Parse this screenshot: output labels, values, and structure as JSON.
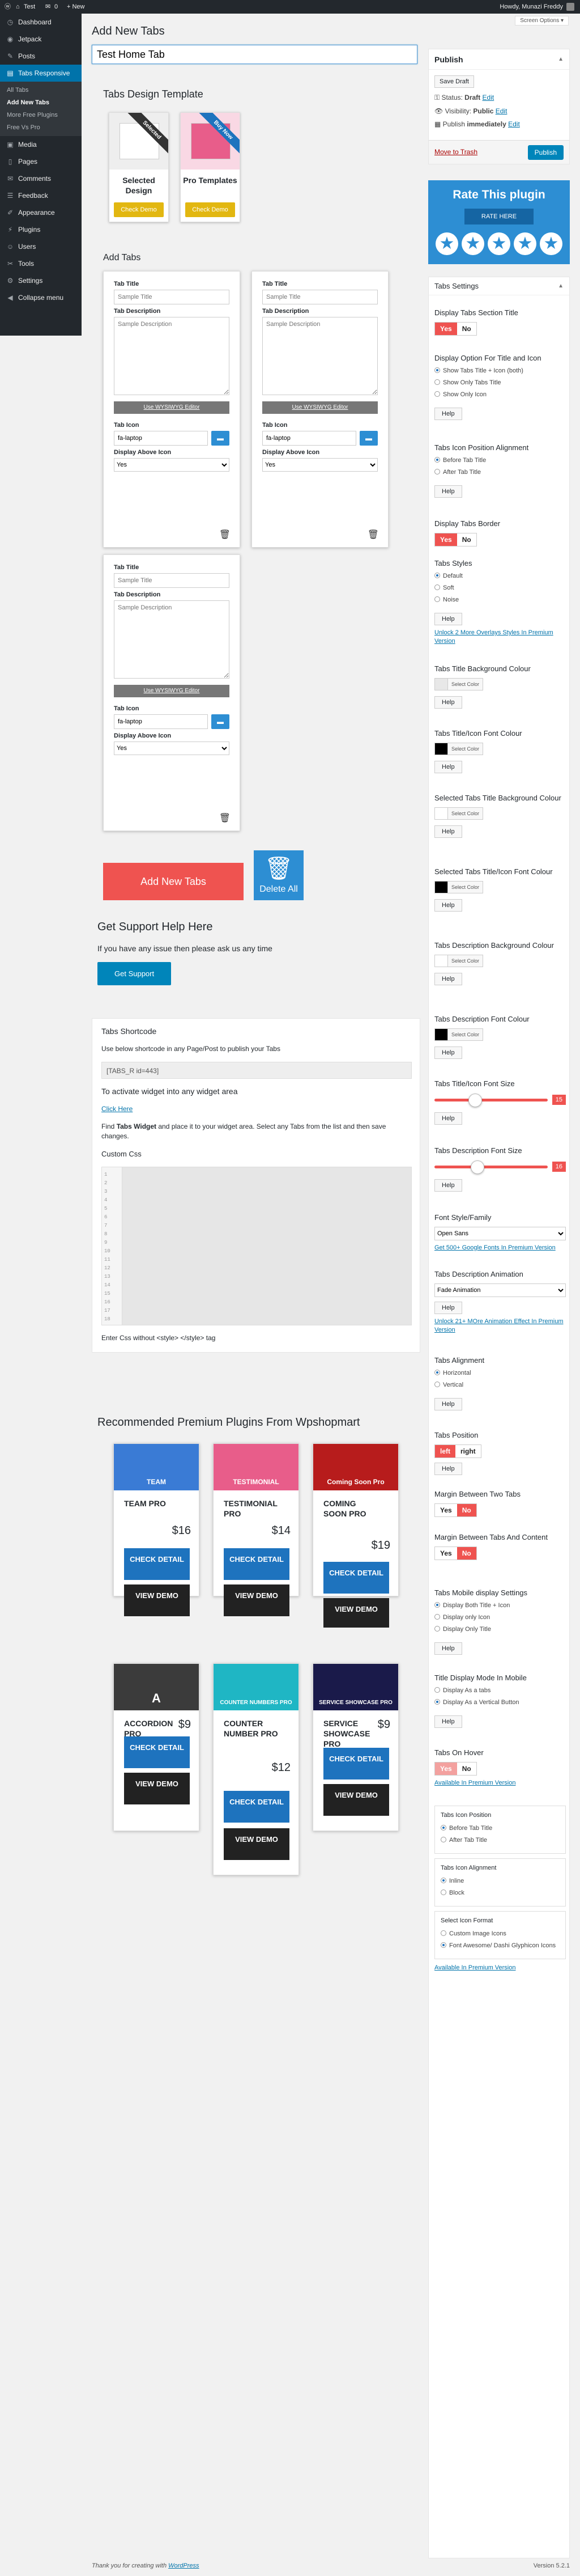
{
  "adminbar": {
    "wp_logo": "wordpress-logo",
    "site_name": "Test",
    "comments_count": "0",
    "new_label": "+ New",
    "greeting": "Howdy, Munazi Freddy"
  },
  "screen_options": "Screen Options ▾",
  "sidebar_menu": {
    "dashboard": "Dashboard",
    "jetpack": "Jetpack",
    "posts": "Posts",
    "tabs_responsive": "Tabs Responsive",
    "sub_all_tabs": "All Tabs",
    "sub_add_new": "Add New Tabs",
    "sub_more_free": "More Free Plugins",
    "sub_free_vs_pro": "Free Vs Pro",
    "media": "Media",
    "pages": "Pages",
    "comments": "Comments",
    "feedback": "Feedback",
    "appearance": "Appearance",
    "plugins": "Plugins",
    "users": "Users",
    "tools": "Tools",
    "settings": "Settings",
    "collapse": "Collapse menu"
  },
  "page": {
    "title": "Add New Tabs",
    "post_title_value": "Test Home Tab"
  },
  "design": {
    "heading": "Tabs Design Template",
    "card1_name": "Selected Design",
    "card1_ribbon": "Selected",
    "card1_button": "Check Demo",
    "card2_name": "Pro Templates",
    "card2_ribbon": "Buy Now",
    "card2_button": "Check Demo"
  },
  "add_tabs": {
    "heading": "Add Tabs",
    "title_label": "Tab Title",
    "title_placeholder": "Sample Title",
    "desc_label": "Tab Description",
    "desc_placeholder": "Sample Description",
    "editor_button": "Use WYSIWYG Editor",
    "icon_label": "Tab Icon",
    "icon_value": "fa-laptop",
    "display_label": "Display Above Icon",
    "display_value": "Yes",
    "add_button": "Add New Tabs",
    "delete_all": "Delete All"
  },
  "support": {
    "heading": "Get Support Help Here",
    "text": "If you have any issue then please ask us any time",
    "button": "Get Support"
  },
  "shortcode": {
    "heading": "Tabs Shortcode",
    "instruction": "Use below shortcode in any Page/Post to publish your Tabs",
    "code": "[TABS_R id=443]",
    "widget_heading": "To activate widget into any widget area",
    "click_here": "Click Here",
    "find_text_1": "Find ",
    "find_bold": "Tabs Widget",
    "find_text_2": " and place it to your widget area. Select any Tabs from the list and then save changes.",
    "custom_css_label": "Custom Css",
    "line_numbers": "1\n2\n3\n4\n5\n6\n7\n8\n9\n10\n11\n12\n13\n14\n15\n16\n17\n18",
    "css_note": "Enter Css without <style> </style> tag"
  },
  "recommended": {
    "heading": "Recommended Premium Plugins From Wpshopmart",
    "check_detail": "CHECK DETAIL",
    "view_demo": "VIEW DEMO",
    "plugins": [
      {
        "name": "TEAM PRO",
        "price": "$16",
        "banner": "TEAM",
        "color": "#3a7bd5"
      },
      {
        "name": "TESTIMONIAL PRO",
        "price": "$14",
        "banner": "TESTIMONIAL",
        "color": "#e85d8a"
      },
      {
        "name": "COMING SOON PRO",
        "price": "$19",
        "banner": "Coming Soon Pro",
        "color": "#b71c1c"
      },
      {
        "name": "ACCORDION PRO",
        "price": "$9",
        "banner": "A",
        "color": "#3b3b3b"
      },
      {
        "name": "COUNTER NUMBER PRO",
        "price": "$12",
        "banner": "COUNTER NUMBERS PRO",
        "color": "#1fb6c4"
      },
      {
        "name": "SERVICE SHOWCASE PRO",
        "price": "$9",
        "banner": "SERVICE SHOWCASE PRO",
        "color": "#1a1a4a"
      }
    ]
  },
  "publish": {
    "heading": "Publish",
    "save_draft": "Save Draft",
    "status": "Status: ",
    "status_value": "Draft",
    "visibility": "Visibility: ",
    "visibility_value": "Public",
    "publish_text": "Publish ",
    "publish_value": "immediately",
    "edit": "Edit",
    "move_trash": "Move to Trash",
    "publish_button": "Publish"
  },
  "rate": {
    "title": "Rate This plugin",
    "button": "RATE HERE",
    "star": "★"
  },
  "settings": {
    "heading": "Tabs Settings",
    "yes": "Yes",
    "no": "No",
    "help": "Help",
    "select_color": "Select Color",
    "display_section_title": "Display Tabs Section Title",
    "display_option": "Display Option For Title and Icon",
    "opt_title_icon": "Show Tabs Title + Icon (both)",
    "opt_only_title": "Show Only Tabs Title",
    "opt_only_icon": "Show Only Icon",
    "icon_position": "Tabs Icon Position Alignment",
    "before_title": "Before Tab Title",
    "after_title": "After Tab Title",
    "display_border": "Display Tabs Border",
    "tabs_styles": "Tabs Styles",
    "style_default": "Default",
    "style_soft": "Soft",
    "style_noise": "Noise",
    "styles_promo": "Unlock 2 More Overlays Styles In Premium Version",
    "title_bg": "Tabs Title Background Colour",
    "title_font_color": "Tabs Title/Icon Font Colour",
    "selected_bg": "Selected Tabs Title Background Colour",
    "selected_font": "Selected Tabs Title/Icon Font Colour",
    "desc_bg": "Tabs Description Background Colour",
    "desc_font": "Tabs Description Font Colour",
    "title_font_size": "Tabs Title/Icon Font Size",
    "title_font_size_value": "15",
    "desc_font_size": "Tabs Description Font Size",
    "desc_font_size_value": "16",
    "font_family": "Font Style/Family",
    "font_family_value": "Open Sans",
    "font_promo": "Get 500+ Google Fonts In Premium Version",
    "animation": "Tabs Description Animation",
    "animation_value": "Fade Animation",
    "animation_promo": "Unlock 21+ MOre Animation Effect In Premium Version",
    "alignment": "Tabs Alignment",
    "horizontal": "Horizontal",
    "vertical": "Vertical",
    "position": "Tabs Position",
    "left": "left",
    "right": "right",
    "margin_tabs": "Margin Between Two Tabs",
    "margin_content": "Margin Between Tabs And Content",
    "mobile": "Tabs Mobile display Settings",
    "mob_both": "Display Both Title + Icon",
    "mob_icon": "Display only Icon",
    "mob_title": "Display Only Title",
    "title_mode": "Title Display Mode In Mobile",
    "mode_tabs": "Display As a tabs",
    "mode_vertical": "Display As a Vertical Button",
    "on_hover": "Tabs On Hover",
    "premium_link": "Available In Premium Version",
    "icon_pos2": "Tabs Icon Position",
    "ip_before": "Before Tab Title",
    "ip_after": "After Tab Title",
    "icon_align": "Tabs Icon Alignment",
    "ia_inline": "Inline",
    "ia_block": "Block",
    "icon_format": "Select Icon Format",
    "if_custom": "Custom Image Icons",
    "if_fa": "Font Awesome/ Dashi Glyphicon Icons"
  },
  "colors": {
    "admin_dark": "#23282d",
    "wp_blue": "#0073aa",
    "accent_red": "#ef5350",
    "accent_blue": "#2d8ed3",
    "black_swatch": "#000000",
    "white_swatch": "#ffffff"
  },
  "footer": {
    "thanks": "Thank you for creating with ",
    "wordpress": "WordPress",
    "version": "Version 5.2.1"
  }
}
